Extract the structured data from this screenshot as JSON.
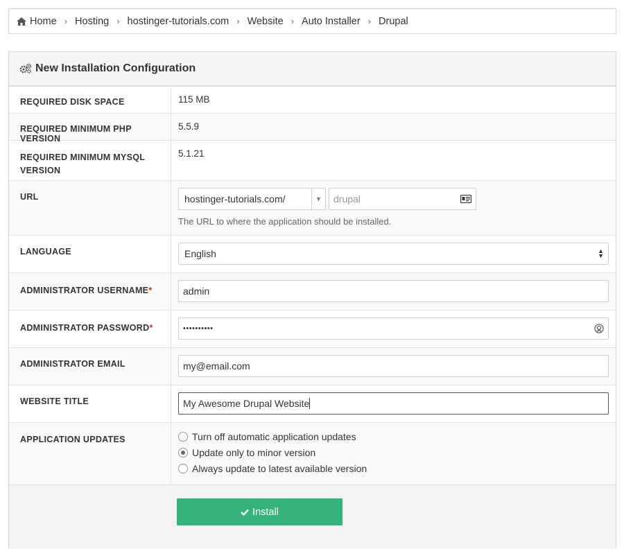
{
  "breadcrumb": {
    "items": [
      "Home",
      "Hosting",
      "hostinger-tutorials.com",
      "Website",
      "Auto Installer",
      "Drupal"
    ]
  },
  "panel": {
    "title": "New Installation Configuration"
  },
  "requirements": {
    "disk_label": "REQUIRED DISK SPACE",
    "disk_value": "115 MB",
    "php_label": "REQUIRED MINIMUM PHP VERSION",
    "php_value": "5.5.9",
    "mysql_label": "REQUIRED MINIMUM MYSQL VERSION",
    "mysql_value": "5.1.21"
  },
  "form": {
    "url_label": "URL",
    "url_domain": "hostinger-tutorials.com/",
    "url_path_placeholder": "drupal",
    "url_help": "The URL to where the application should be installed.",
    "language_label": "LANGUAGE",
    "language_value": "English",
    "username_label": "ADMINISTRATOR USERNAME",
    "username_value": "admin",
    "password_label": "ADMINISTRATOR PASSWORD",
    "password_value": "••••••••••",
    "email_label": "ADMINISTRATOR EMAIL",
    "email_value": "my@email.com",
    "title_label": "WEBSITE TITLE",
    "title_value": "My Awesome Drupal Website",
    "required_mark": "*",
    "updates_label": "APPLICATION UPDATES",
    "update_options": [
      "Turn off automatic application updates",
      "Update only to minor version",
      "Always update to latest available version"
    ],
    "update_selected_index": 1
  },
  "actions": {
    "install_label": "Install"
  },
  "colors": {
    "install_button": "#35b37a",
    "required_mark": "#c9302c"
  }
}
